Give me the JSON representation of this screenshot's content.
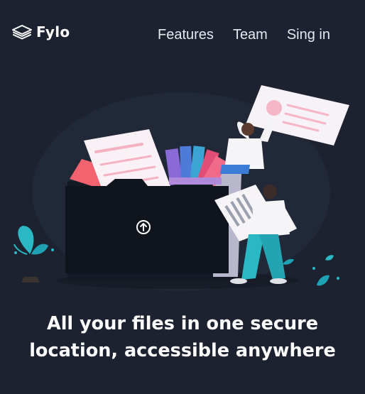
{
  "brand": {
    "logo_icon": "stacked-layers-icon",
    "name": "Fylo"
  },
  "nav": {
    "links": [
      {
        "label": "Features"
      },
      {
        "label": "Team"
      },
      {
        "label": "Sing in"
      }
    ]
  },
  "hero": {
    "illustration_icon": "upload-icon",
    "headline": "All your files in one secure location, accessible anywhere"
  },
  "colors": {
    "background": "#1c2230",
    "text": "#ffffff",
    "accent_cyan": "#2bb8c5",
    "accent_pink": "#f06a8a",
    "folder": "#0f141d"
  }
}
